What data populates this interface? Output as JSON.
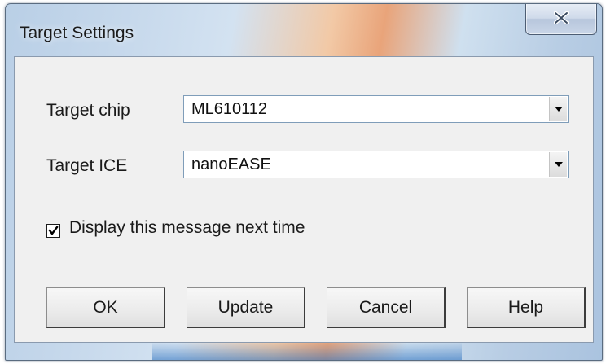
{
  "window": {
    "title": "Target Settings",
    "close_icon": "close-icon"
  },
  "form": {
    "chip_label": "Target chip",
    "chip_value": "ML610112",
    "ice_label": "Target ICE",
    "ice_value": "nanoEASE",
    "dropdown_icon": "chevron-down-icon"
  },
  "checkbox": {
    "label": "Display this message next time",
    "checked": true
  },
  "buttons": {
    "ok": "OK",
    "update": "Update",
    "cancel": "Cancel",
    "help": "Help"
  }
}
